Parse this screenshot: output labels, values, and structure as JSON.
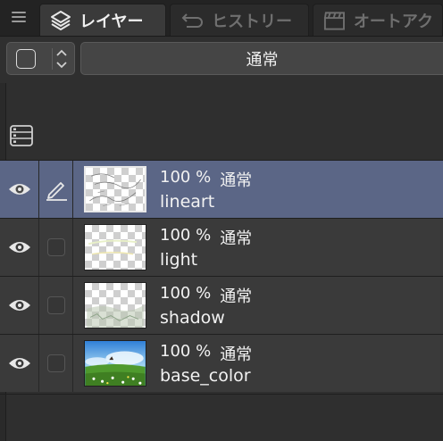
{
  "tabs": [
    {
      "label": "レイヤー",
      "icon": "layers-icon",
      "active": true
    },
    {
      "label": "ヒストリー",
      "icon": "undo-icon",
      "active": false
    },
    {
      "label": "オートアク",
      "icon": "clapperboard-icon",
      "active": false
    }
  ],
  "blend_mode": "通常",
  "layers": [
    {
      "opacity": "100 %",
      "blend": "通常",
      "name": "lineart",
      "selected": true,
      "editing": true
    },
    {
      "opacity": "100 %",
      "blend": "通常",
      "name": "light",
      "selected": false,
      "editing": false
    },
    {
      "opacity": "100 %",
      "blend": "通常",
      "name": "shadow",
      "selected": false,
      "editing": false
    },
    {
      "opacity": "100 %",
      "blend": "通常",
      "name": "base_color",
      "selected": false,
      "editing": false
    }
  ],
  "colors": {
    "panel_bg": "#2f2f2f",
    "row_bg": "#3a3a3a",
    "selected_row": "#5b6686"
  }
}
